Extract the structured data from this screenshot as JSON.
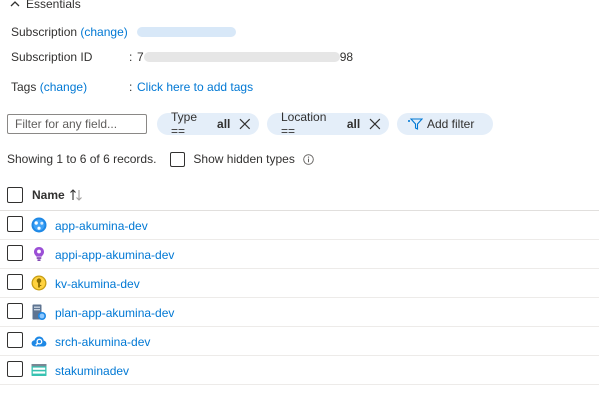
{
  "essentials": {
    "title": "Essentials"
  },
  "subscription": {
    "label": "Subscription",
    "change_link": "(change)"
  },
  "subscription_id": {
    "label": "Subscription ID",
    "colon": ":",
    "value_prefix": "7",
    "value_suffix": "98"
  },
  "tags": {
    "label": "Tags",
    "change_link": "(change)",
    "colon": ":",
    "add_link": "Click here to add tags"
  },
  "filters": {
    "search_placeholder": "Filter for any field...",
    "type_filter": {
      "label": "Type ==",
      "value": "all"
    },
    "location_filter": {
      "label": "Location ==",
      "value": "all"
    },
    "add_filter_label": "Add filter"
  },
  "records": {
    "showing_text": "Showing 1 to 6 of 6 records.",
    "show_hidden_label": "Show hidden types"
  },
  "grid": {
    "name_header": "Name"
  },
  "resources": [
    {
      "name": "app-akumina-dev",
      "icon": "app-service-icon"
    },
    {
      "name": "appi-app-akumina-dev",
      "icon": "application-insights-icon"
    },
    {
      "name": "kv-akumina-dev",
      "icon": "key-vault-icon"
    },
    {
      "name": "plan-app-akumina-dev",
      "icon": "app-service-plan-icon"
    },
    {
      "name": "srch-akumina-dev",
      "icon": "search-service-icon"
    },
    {
      "name": "stakuminadev",
      "icon": "storage-account-icon"
    }
  ],
  "colors": {
    "link": "#0078d4",
    "pill_bg": "#e4eef9",
    "text": "#323130"
  }
}
